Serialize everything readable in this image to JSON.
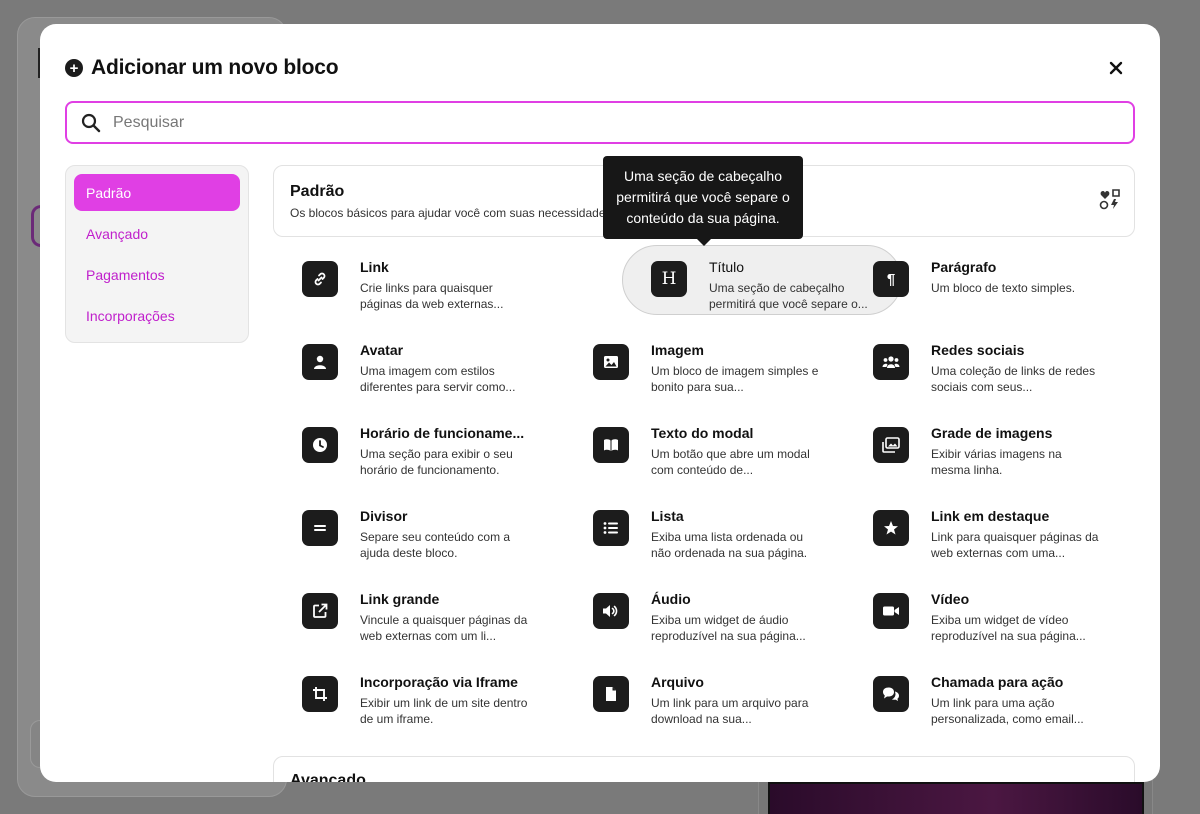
{
  "modal": {
    "title": "Adicionar um novo bloco",
    "close_label": "×"
  },
  "search": {
    "placeholder": "Pesquisar"
  },
  "sidebar": {
    "items": [
      {
        "label": "Padrão",
        "active": true
      },
      {
        "label": "Avançado",
        "active": false
      },
      {
        "label": "Pagamentos",
        "active": false
      },
      {
        "label": "Incorporações",
        "active": false
      }
    ]
  },
  "category": {
    "title": "Padrão",
    "description": "Os blocos básicos para ajudar você com suas necessidades g"
  },
  "blocks": [
    {
      "title": "Link",
      "description": "Crie links para quaisquer páginas da web externas...",
      "icon": "link-icon"
    },
    {
      "title": "Título",
      "description": "Uma seção de cabeçalho permitirá que você separe o...",
      "icon": "heading-icon"
    },
    {
      "title": "Parágrafo",
      "description": "Um bloco de texto simples.",
      "icon": "paragraph-icon"
    },
    {
      "title": "Avatar",
      "description": "Uma imagem com estilos diferentes para servir como...",
      "icon": "user-icon"
    },
    {
      "title": "Imagem",
      "description": "Um bloco de imagem simples e bonito para sua...",
      "icon": "image-icon"
    },
    {
      "title": "Redes sociais",
      "description": "Uma coleção de links de redes sociais com seus...",
      "icon": "users-icon"
    },
    {
      "title": "Horário de funcioname...",
      "description": "Uma seção para exibir o seu horário de funcionamento.",
      "icon": "clock-icon"
    },
    {
      "title": "Texto do modal",
      "description": "Um botão que abre um modal com conteúdo de...",
      "icon": "book-icon"
    },
    {
      "title": "Grade de imagens",
      "description": "Exibir várias imagens na mesma linha.",
      "icon": "images-icon"
    },
    {
      "title": "Divisor",
      "description": "Separe seu conteúdo com a ajuda deste bloco.",
      "icon": "divider-icon"
    },
    {
      "title": "Lista",
      "description": "Exiba uma lista ordenada ou não ordenada na sua página.",
      "icon": "list-icon"
    },
    {
      "title": "Link em destaque",
      "description": "Link para quaisquer páginas da web externas com uma...",
      "icon": "star-icon"
    },
    {
      "title": "Link grande",
      "description": "Vincule a quaisquer páginas da web externas com um li...",
      "icon": "external-link-icon"
    },
    {
      "title": "Áudio",
      "description": "Exiba um widget de áudio reproduzível na sua página...",
      "icon": "volume-icon"
    },
    {
      "title": "Vídeo",
      "description": "Exiba um widget de vídeo reproduzível na sua página...",
      "icon": "video-icon"
    },
    {
      "title": "Incorporação via Iframe",
      "description": "Exibir um link de um site dentro de um iframe.",
      "icon": "crop-icon"
    },
    {
      "title": "Arquivo",
      "description": "Um link para um arquivo para download na sua...",
      "icon": "file-icon"
    },
    {
      "title": "Chamada para ação",
      "description": "Um link para uma ação personalizada, como email...",
      "icon": "comments-icon"
    }
  ],
  "next_section": {
    "title": "Avançado"
  },
  "tooltip": {
    "text": "Uma seção de cabeçalho permitirá que você separe o conteúdo da sua página."
  },
  "colors": {
    "accent": "#e03fe4",
    "accent_text": "#c01fcc",
    "icon_bg": "#1c1c1c"
  }
}
